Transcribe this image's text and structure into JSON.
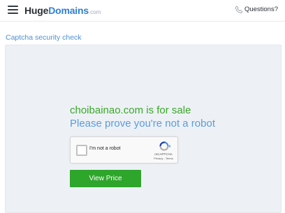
{
  "header": {
    "logo": {
      "huge": "Huge",
      "domains": "Domains",
      "tld": ".com"
    },
    "menu_icon": "hamburger-menu-icon",
    "questions_icon": "phone-icon",
    "questions_label": "Questions?"
  },
  "page": {
    "captcha_title": "Captcha security check",
    "headline": "choibainao.com is for sale",
    "subline": "Please prove you're not a robot",
    "cta_label": "View Price"
  },
  "recaptcha": {
    "label": "I'm not a robot",
    "brand": "reCAPTCHA",
    "terms": "Privacy - Terms",
    "logo_icon": "recaptcha-logo-icon"
  },
  "colors": {
    "logo_accent": "#2f7fd4",
    "link": "#4a90d9",
    "headline_green": "#3ba72c",
    "subline_blue": "#5b9be0",
    "button_green": "#2ea52b",
    "panel_bg": "#edf1f5"
  }
}
